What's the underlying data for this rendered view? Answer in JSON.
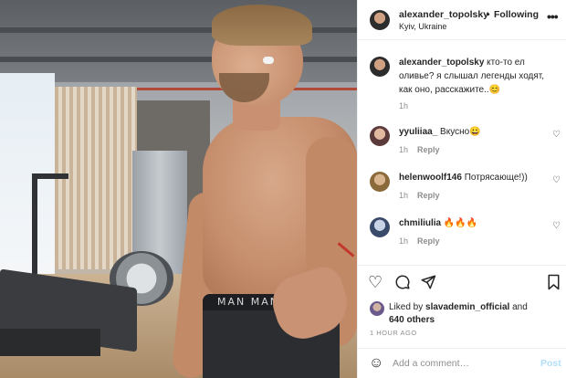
{
  "post": {
    "image_alt": "",
    "waistband_text": "MAN MAN"
  },
  "header": {
    "username": "alexander_topolsky",
    "separator": "•",
    "follow_state": "Following",
    "location": "Kyiv, Ukraine",
    "more_icon": "more-horizontal-icon"
  },
  "caption": {
    "username": "alexander_topolsky",
    "text": "кто-то ел оливье? я слышал легенды ходят, как оно, расскажите..😊",
    "time": "1h"
  },
  "comments": [
    {
      "username": "yyuliiaa_",
      "text": "Вкусно😀",
      "time": "1h",
      "reply": "Reply",
      "avatar_color": "#5a3a3a"
    },
    {
      "username": "helenwoolf146",
      "text": "Потрясающе!))",
      "time": "1h",
      "reply": "Reply",
      "avatar_color": "#8a6a3a"
    },
    {
      "username": "chmiliulia",
      "text": "🔥🔥🔥",
      "time": "1h",
      "reply": "Reply",
      "avatar_color": "#3a4a6a"
    }
  ],
  "actions": {
    "like_icon": "heart-icon",
    "comment_icon": "comment-icon",
    "share_icon": "paper-plane-icon",
    "save_icon": "bookmark-icon"
  },
  "likes": {
    "prefix": "Liked by",
    "user": "slavademin_official",
    "joiner": "and",
    "others": "640 others"
  },
  "post_time": "1 HOUR AGO",
  "add_comment": {
    "placeholder": "Add a comment…",
    "post_label": "Post"
  }
}
